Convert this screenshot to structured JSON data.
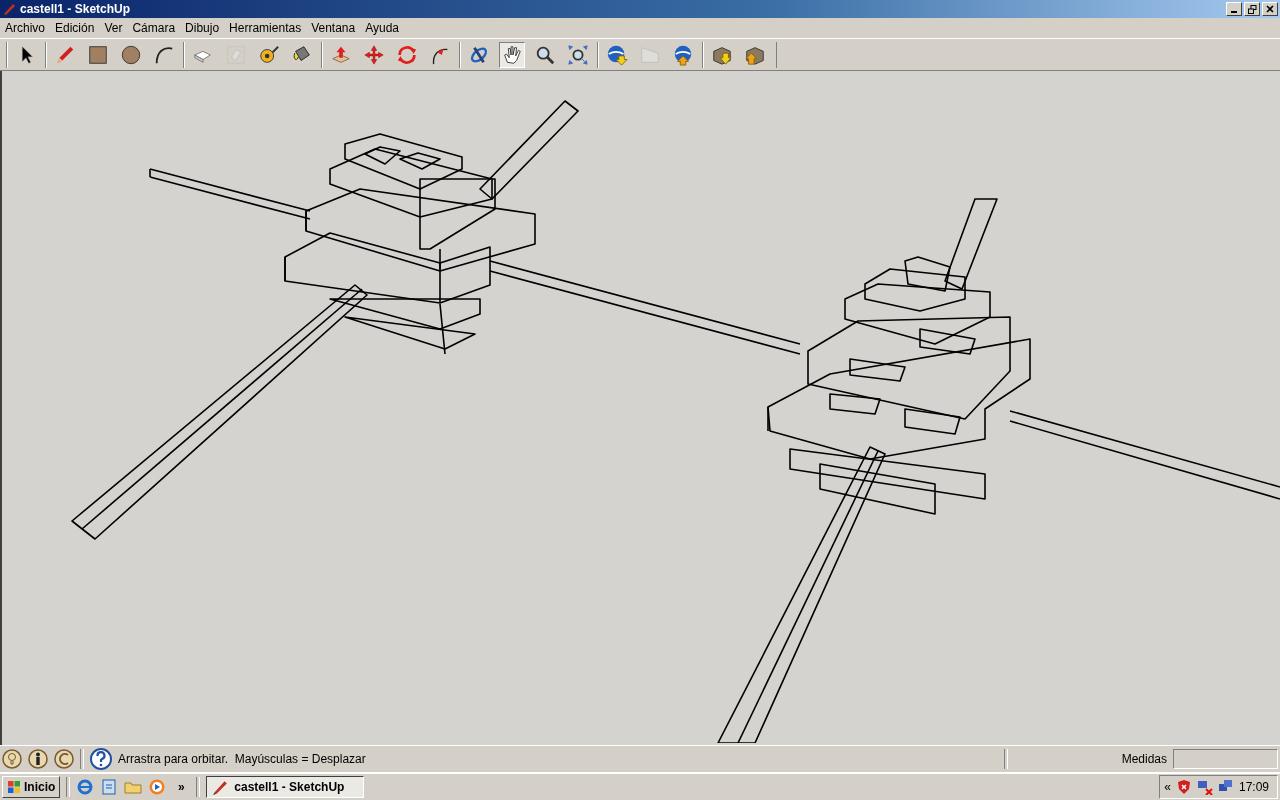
{
  "window": {
    "title": "castell1 - SketchUp"
  },
  "menu": [
    "Archivo",
    "Edición",
    "Ver",
    "Cámara",
    "Dibujo",
    "Herramientas",
    "Ventana",
    "Ayuda"
  ],
  "toolbar": [
    [
      {
        "selected": false,
        "disabled": false
      }
    ],
    [
      {
        "selected": false,
        "disabled": false
      },
      {
        "selected": false,
        "disabled": false
      },
      {
        "selected": false,
        "disabled": false
      },
      {
        "selected": false,
        "disabled": false
      }
    ],
    [
      {
        "selected": false,
        "disabled": false
      },
      {
        "selected": false,
        "disabled": true
      },
      {
        "selected": false,
        "disabled": false
      },
      {
        "selected": false,
        "disabled": false
      }
    ],
    [
      {
        "selected": false,
        "disabled": false
      },
      {
        "selected": false,
        "disabled": false
      },
      {
        "selected": false,
        "disabled": false
      },
      {
        "selected": false,
        "disabled": false
      }
    ],
    [
      {
        "selected": false,
        "disabled": false
      },
      {
        "selected": true,
        "disabled": false
      },
      {
        "selected": false,
        "disabled": false
      },
      {
        "selected": false,
        "disabled": false
      }
    ],
    [
      {
        "selected": false,
        "disabled": false
      },
      {
        "selected": false,
        "disabled": true
      },
      {
        "selected": false,
        "disabled": false
      }
    ],
    [
      {
        "selected": false,
        "disabled": false
      },
      {
        "selected": false,
        "disabled": false
      }
    ]
  ],
  "status_bar": {
    "hint": "Arrastra para orbitar.  Mayúsculas = Desplazar",
    "measurements_label": "Medidas"
  },
  "taskbar": {
    "start": "Inicio",
    "overflow": "»",
    "tasks": [
      {
        "label": "castell1 - SketchUp",
        "selected": true
      }
    ],
    "tray_expander": "«",
    "clock": "17:09"
  }
}
